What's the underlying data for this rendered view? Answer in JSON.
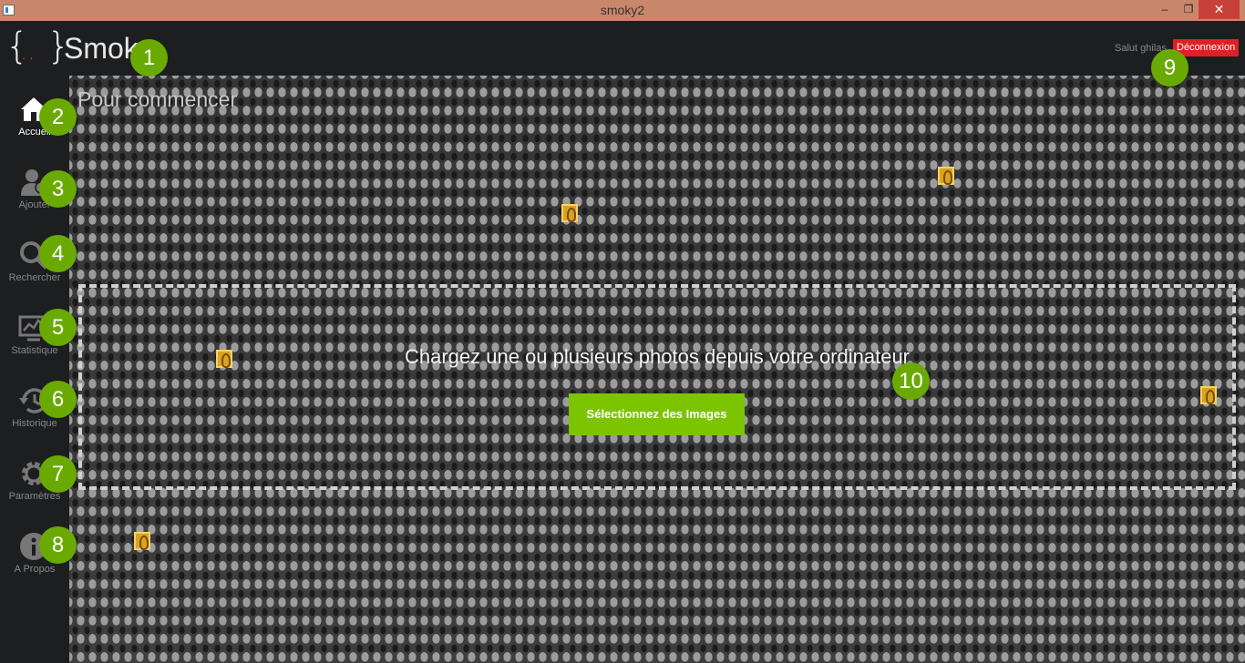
{
  "window": {
    "title": "smoky2"
  },
  "header": {
    "logo_left": "{",
    "logo_dots": "..",
    "logo_right": "}",
    "brand": "Smoky",
    "greeting": "Salut ghilas",
    "logout_label": "Déconnexion",
    "logout_color": "#e02025"
  },
  "sidebar": {
    "items": [
      {
        "label": "Accueil",
        "icon": "home-icon",
        "active": true
      },
      {
        "label": "Ajouter",
        "icon": "add-user-icon"
      },
      {
        "label": "Rechercher",
        "icon": "search-icon"
      },
      {
        "label": "Statistique",
        "icon": "chart-icon"
      },
      {
        "label": "Historique",
        "icon": "history-icon"
      },
      {
        "label": "Paramètres",
        "icon": "gear-icon"
      },
      {
        "label": "A Propos",
        "icon": "info-icon"
      }
    ]
  },
  "main": {
    "title": "Pour commencer",
    "dropzone_text": "Chargez une ou plusieurs photos depuis votre ordinateur",
    "select_button": "Sélectionnez des Images",
    "accent_color": "#7cc400"
  },
  "markers": [
    "1",
    "2",
    "3",
    "4",
    "5",
    "6",
    "7",
    "8",
    "9",
    "10"
  ]
}
